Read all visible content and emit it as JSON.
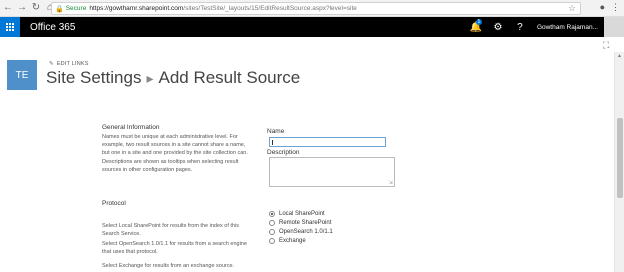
{
  "browser": {
    "secure_label": "Secure",
    "url_host": "https://gowthamr.sharepoint.com",
    "url_path": "/sites/TestSite/_layouts/15/EditResultSource.aspx?level=site"
  },
  "suitebar": {
    "app_title": "Office 365",
    "notification_count": "1",
    "user_name": "Gowtham Rajaman..."
  },
  "header": {
    "site_logo_text": "TE",
    "edit_links": "EDIT LINKS",
    "breadcrumb_root": "Site Settings",
    "breadcrumb_current": "Add Result Source"
  },
  "general": {
    "heading": "General Information",
    "desc1": "Names must be unique at each administrative level. For example, two result sources in a site cannot share a name, but one in a site and one provided by the site collection can.",
    "desc2": "Descriptions are shown as tooltips when selecting result sources in other configuration pages.",
    "name_label": "Name",
    "name_value": "",
    "description_label": "Description",
    "description_value": ""
  },
  "protocol": {
    "heading": "Protocol",
    "desc1": "Select Local SharePoint for results from the index of this Search Service.",
    "desc2": "Select OpenSearch 1.0/1.1 for results from a search engine that uses that protocol.",
    "desc3": "Select Exchange for results from an exchange source.",
    "options": [
      "Local SharePoint",
      "Remote SharePoint",
      "OpenSearch 1.0/1.1",
      "Exchange"
    ],
    "selected": "Local SharePoint"
  }
}
